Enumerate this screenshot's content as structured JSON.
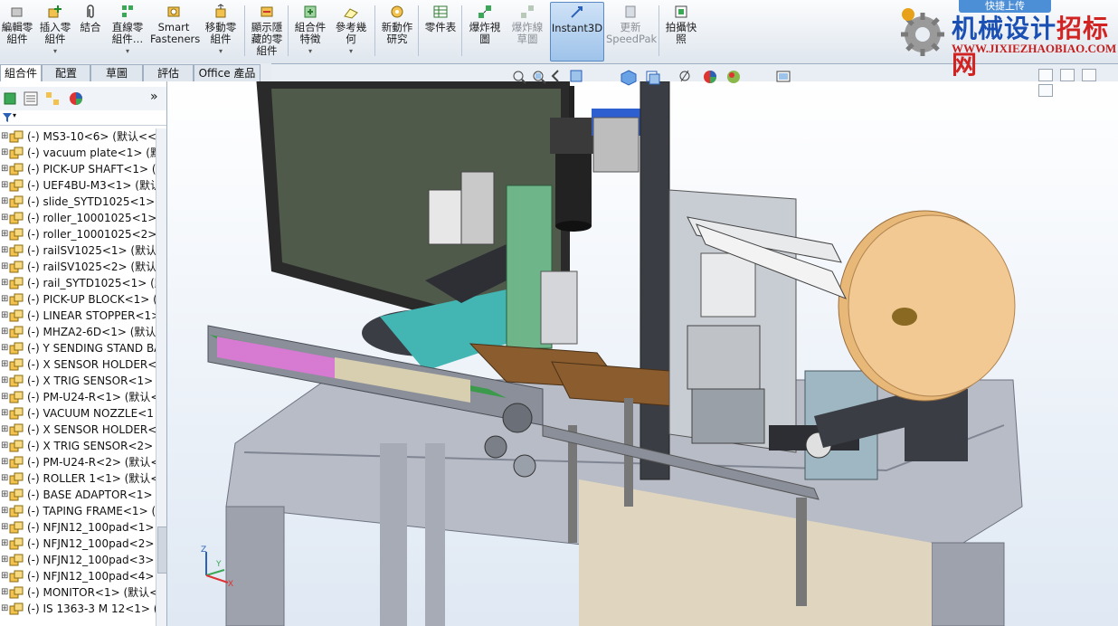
{
  "ribbon": {
    "buttons": [
      {
        "label": "編輯零\n組件"
      },
      {
        "label": "插入零\n組件"
      },
      {
        "label": "結合"
      },
      {
        "label": "直線零\n組件…"
      },
      {
        "label": "Smart\nFasteners"
      },
      {
        "label": "移動零\n組件"
      },
      {
        "label": "顯示隱\n藏的零\n組件"
      },
      {
        "label": "組合件\n特徵"
      },
      {
        "label": "參考幾\n何"
      },
      {
        "label": "新動作\n研究"
      },
      {
        "label": "零件表"
      },
      {
        "label": "爆炸視\n圖"
      },
      {
        "label": "爆炸線\n草圖"
      },
      {
        "label": "Instant3D"
      },
      {
        "label": "更新\nSpeedPak"
      },
      {
        "label": "拍攝快\n照"
      }
    ],
    "active_button": "Instant3D"
  },
  "watermark": {
    "title_part1": "机械设计",
    "title_part2": "招标网",
    "url": "WWW.JIXIEZHAOBIAO.COM",
    "upload_label": "快捷上传"
  },
  "tabs": [
    "組合件",
    "配置",
    "草圖",
    "評估",
    "Office 產品"
  ],
  "active_tab": "組合件",
  "tree": {
    "items": [
      "(-) MS3-10<6> (默认<<",
      "(-) vacuum plate<1> (默",
      "(-) PICK-UP SHAFT<1> (",
      "(-) UEF4BU-M3<1> (默认",
      "(-) slide_SYTD1025<1> (",
      "(-) roller_10001025<1> (",
      "(-) roller_10001025<2> (",
      "(-) railSV1025<1> (默认<",
      "(-) railSV1025<2> (默认<",
      "(-) rail_SYTD1025<1> (默",
      "(-) PICK-UP BLOCK<1> (",
      "(-) LINEAR STOPPER<1>",
      "(-) MHZA2-6D<1> (默认",
      "(-) Y SENDING STAND BA",
      "(-) X SENSOR HOLDER<",
      "(-) X TRIG SENSOR<1> (",
      "(-) PM-U24-R<1> (默认<",
      "(-) VACUUM NOZZLE<1",
      "(-) X SENSOR HOLDER<",
      "(-) X TRIG SENSOR<2> (",
      "(-) PM-U24-R<2> (默认<",
      "(-) ROLLER 1<1> (默认<",
      "(-) BASE ADAPTOR<1> (",
      "(-) TAPING FRAME<1> (",
      "(-) NFJN12_100pad<1>",
      "(-) NFJN12_100pad<2>",
      "(-) NFJN12_100pad<3>",
      "(-) NFJN12_100pad<4>",
      "(-) MONITOR<1> (默认<",
      "(-) IS 1363-3 M 12<1> ("
    ]
  },
  "triad": {
    "x": "X",
    "y": "Y",
    "z": "Z"
  },
  "colors": {
    "ribbon_bg": "#dfe6ee",
    "accent": "#5b8ac2",
    "viewport_bg": "#eef3f9"
  }
}
